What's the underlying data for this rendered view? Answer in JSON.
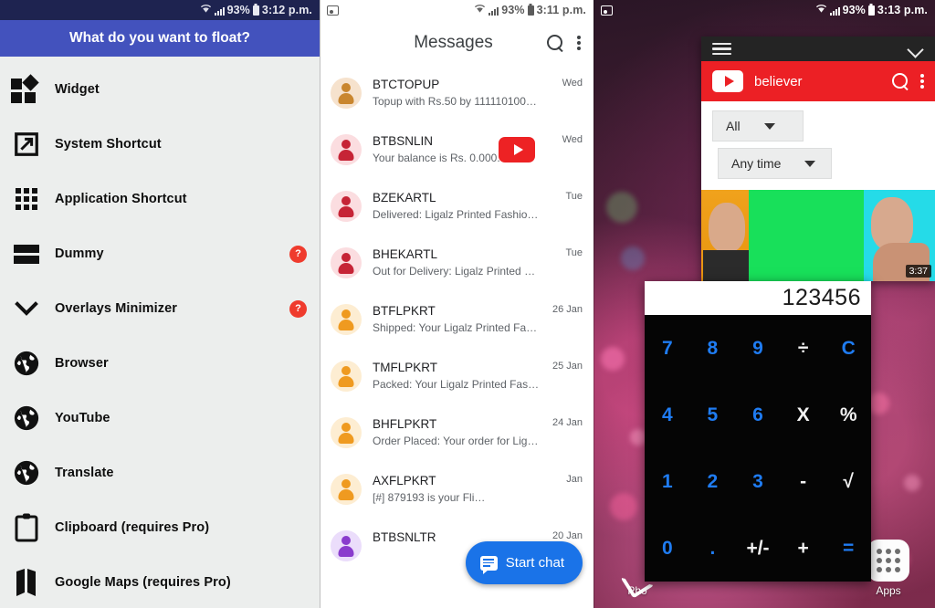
{
  "panel1": {
    "status": {
      "time": "3:12 p.m.",
      "battery": "93%",
      "wifi_icon": "wifi-icon",
      "signal_icon": "signal-icon",
      "battery_icon": "battery-icon"
    },
    "header_title": "What do you want to float?",
    "items": [
      {
        "label": "Widget",
        "icon": "widget-icon",
        "help": false
      },
      {
        "label": "System Shortcut",
        "icon": "external-link-icon",
        "help": false
      },
      {
        "label": "Application Shortcut",
        "icon": "grid-icon",
        "help": false
      },
      {
        "label": "Dummy",
        "icon": "bars-icon",
        "help": true,
        "help_label": "?"
      },
      {
        "label": "Overlays Minimizer",
        "icon": "chevron-down-icon",
        "help": true,
        "help_label": "?"
      },
      {
        "label": "Browser",
        "icon": "globe-icon",
        "help": false
      },
      {
        "label": "YouTube",
        "icon": "globe-icon",
        "help": false
      },
      {
        "label": "Translate",
        "icon": "globe-icon",
        "help": false
      },
      {
        "label": "Clipboard (requires Pro)",
        "icon": "clipboard-icon",
        "help": false
      },
      {
        "label": "Google Maps (requires Pro)",
        "icon": "map-icon",
        "help": false
      }
    ]
  },
  "panel2": {
    "status": {
      "time": "3:11 p.m.",
      "battery": "93%",
      "left_icon": "screenshot-icon"
    },
    "appbar": {
      "title": "Messages",
      "search_icon": "search-icon",
      "overflow_icon": "more-vertical-icon"
    },
    "messages": [
      {
        "name": "BTCTOPUP",
        "preview": "Topup with Rs.50 by 1111101009 o…",
        "date": "Wed",
        "avatar": "#f6e2cd",
        "avatar_fg": "#c9862f",
        "badge": "youtube-play-badge"
      },
      {
        "name": "BTBSNLIN",
        "preview": "Your balance is Rs. 0.000.",
        "date": "Wed",
        "avatar": "#fbdde0",
        "avatar_fg": "#c62436"
      },
      {
        "name": "BZEKARTL",
        "preview": "Delivered: Ligalz Printed Fashion… fr…",
        "date": "Tue",
        "avatar": "#fbdde0",
        "avatar_fg": "#c62436"
      },
      {
        "name": "BHEKARTL",
        "preview": "Out for Delivery: Ligalz Printed Fashi…",
        "date": "Tue",
        "avatar": "#fbdde0",
        "avatar_fg": "#c62436"
      },
      {
        "name": "BTFLPKRT",
        "preview": "Shipped: Your Ligalz Printed Fashi…",
        "date": "26 Jan",
        "avatar": "#fdedd2",
        "avatar_fg": "#ef9a20"
      },
      {
        "name": "TMFLPKRT",
        "preview": "Packed: Your Ligalz Printed Fashi…",
        "date": "25 Jan",
        "avatar": "#fdedd2",
        "avatar_fg": "#ef9a20"
      },
      {
        "name": "BHFLPKRT",
        "preview": "Order Placed: Your order for Ligal…",
        "date": "24 Jan",
        "avatar": "#fdedd2",
        "avatar_fg": "#ef9a20"
      },
      {
        "name": "AXFLPKRT",
        "preview": "[#] 879193 is your Fli…",
        "date": "Jan",
        "avatar": "#fdedd2",
        "avatar_fg": "#ef9a20"
      },
      {
        "name": "BTBSNLTR",
        "preview": "",
        "date": "20 Jan",
        "avatar": "#ebddfb",
        "avatar_fg": "#8a3ccd"
      }
    ],
    "fab": {
      "label": "Start chat",
      "icon": "chat-bubble-icon"
    }
  },
  "panel3": {
    "status": {
      "time": "3:13 p.m.",
      "battery": "93%",
      "left_icon": "screenshot-icon"
    },
    "youtube_window": {
      "titlebar": {
        "menu_icon": "hamburger-icon",
        "minimize_icon": "chevron-down-icon"
      },
      "appbar": {
        "logo": "youtube-logo-icon",
        "query": "believer",
        "search_icon": "search-icon",
        "overflow_icon": "more-vertical-icon"
      },
      "filters": [
        {
          "label": "All",
          "caret": "caret-down-icon"
        },
        {
          "label": "Any time",
          "caret": "caret-down-icon"
        }
      ],
      "result": {
        "duration": "3:37"
      }
    },
    "calculator": {
      "display": "123456",
      "keys": [
        {
          "label": "7",
          "type": "num"
        },
        {
          "label": "8",
          "type": "num"
        },
        {
          "label": "9",
          "type": "num"
        },
        {
          "label": "÷",
          "type": "op"
        },
        {
          "label": "C",
          "type": "eq"
        },
        {
          "label": "4",
          "type": "num"
        },
        {
          "label": "5",
          "type": "num"
        },
        {
          "label": "6",
          "type": "num"
        },
        {
          "label": "X",
          "type": "op"
        },
        {
          "label": "%",
          "type": "op"
        },
        {
          "label": "1",
          "type": "num"
        },
        {
          "label": "2",
          "type": "num"
        },
        {
          "label": "3",
          "type": "num"
        },
        {
          "label": "-",
          "type": "op"
        },
        {
          "label": "√",
          "type": "op"
        },
        {
          "label": "0",
          "type": "num"
        },
        {
          "label": ".",
          "type": "num"
        },
        {
          "label": "+/-",
          "type": "op"
        },
        {
          "label": "+",
          "type": "op"
        },
        {
          "label": "=",
          "type": "eq"
        }
      ]
    },
    "dock": [
      {
        "label": "Pho",
        "icon": "phone-icon"
      },
      {
        "label": "Apps",
        "icon": "apps-grid-icon"
      }
    ]
  },
  "colors": {
    "panel1_header": "#4352bd",
    "panel1_statusbar": "#1e2350",
    "panel1_bg": "#eceeed",
    "help_badge": "#ef3b2d",
    "fab_blue": "#1a73e8",
    "youtube_red": "#ec2025",
    "calc_num_blue": "#1f7cf2"
  }
}
